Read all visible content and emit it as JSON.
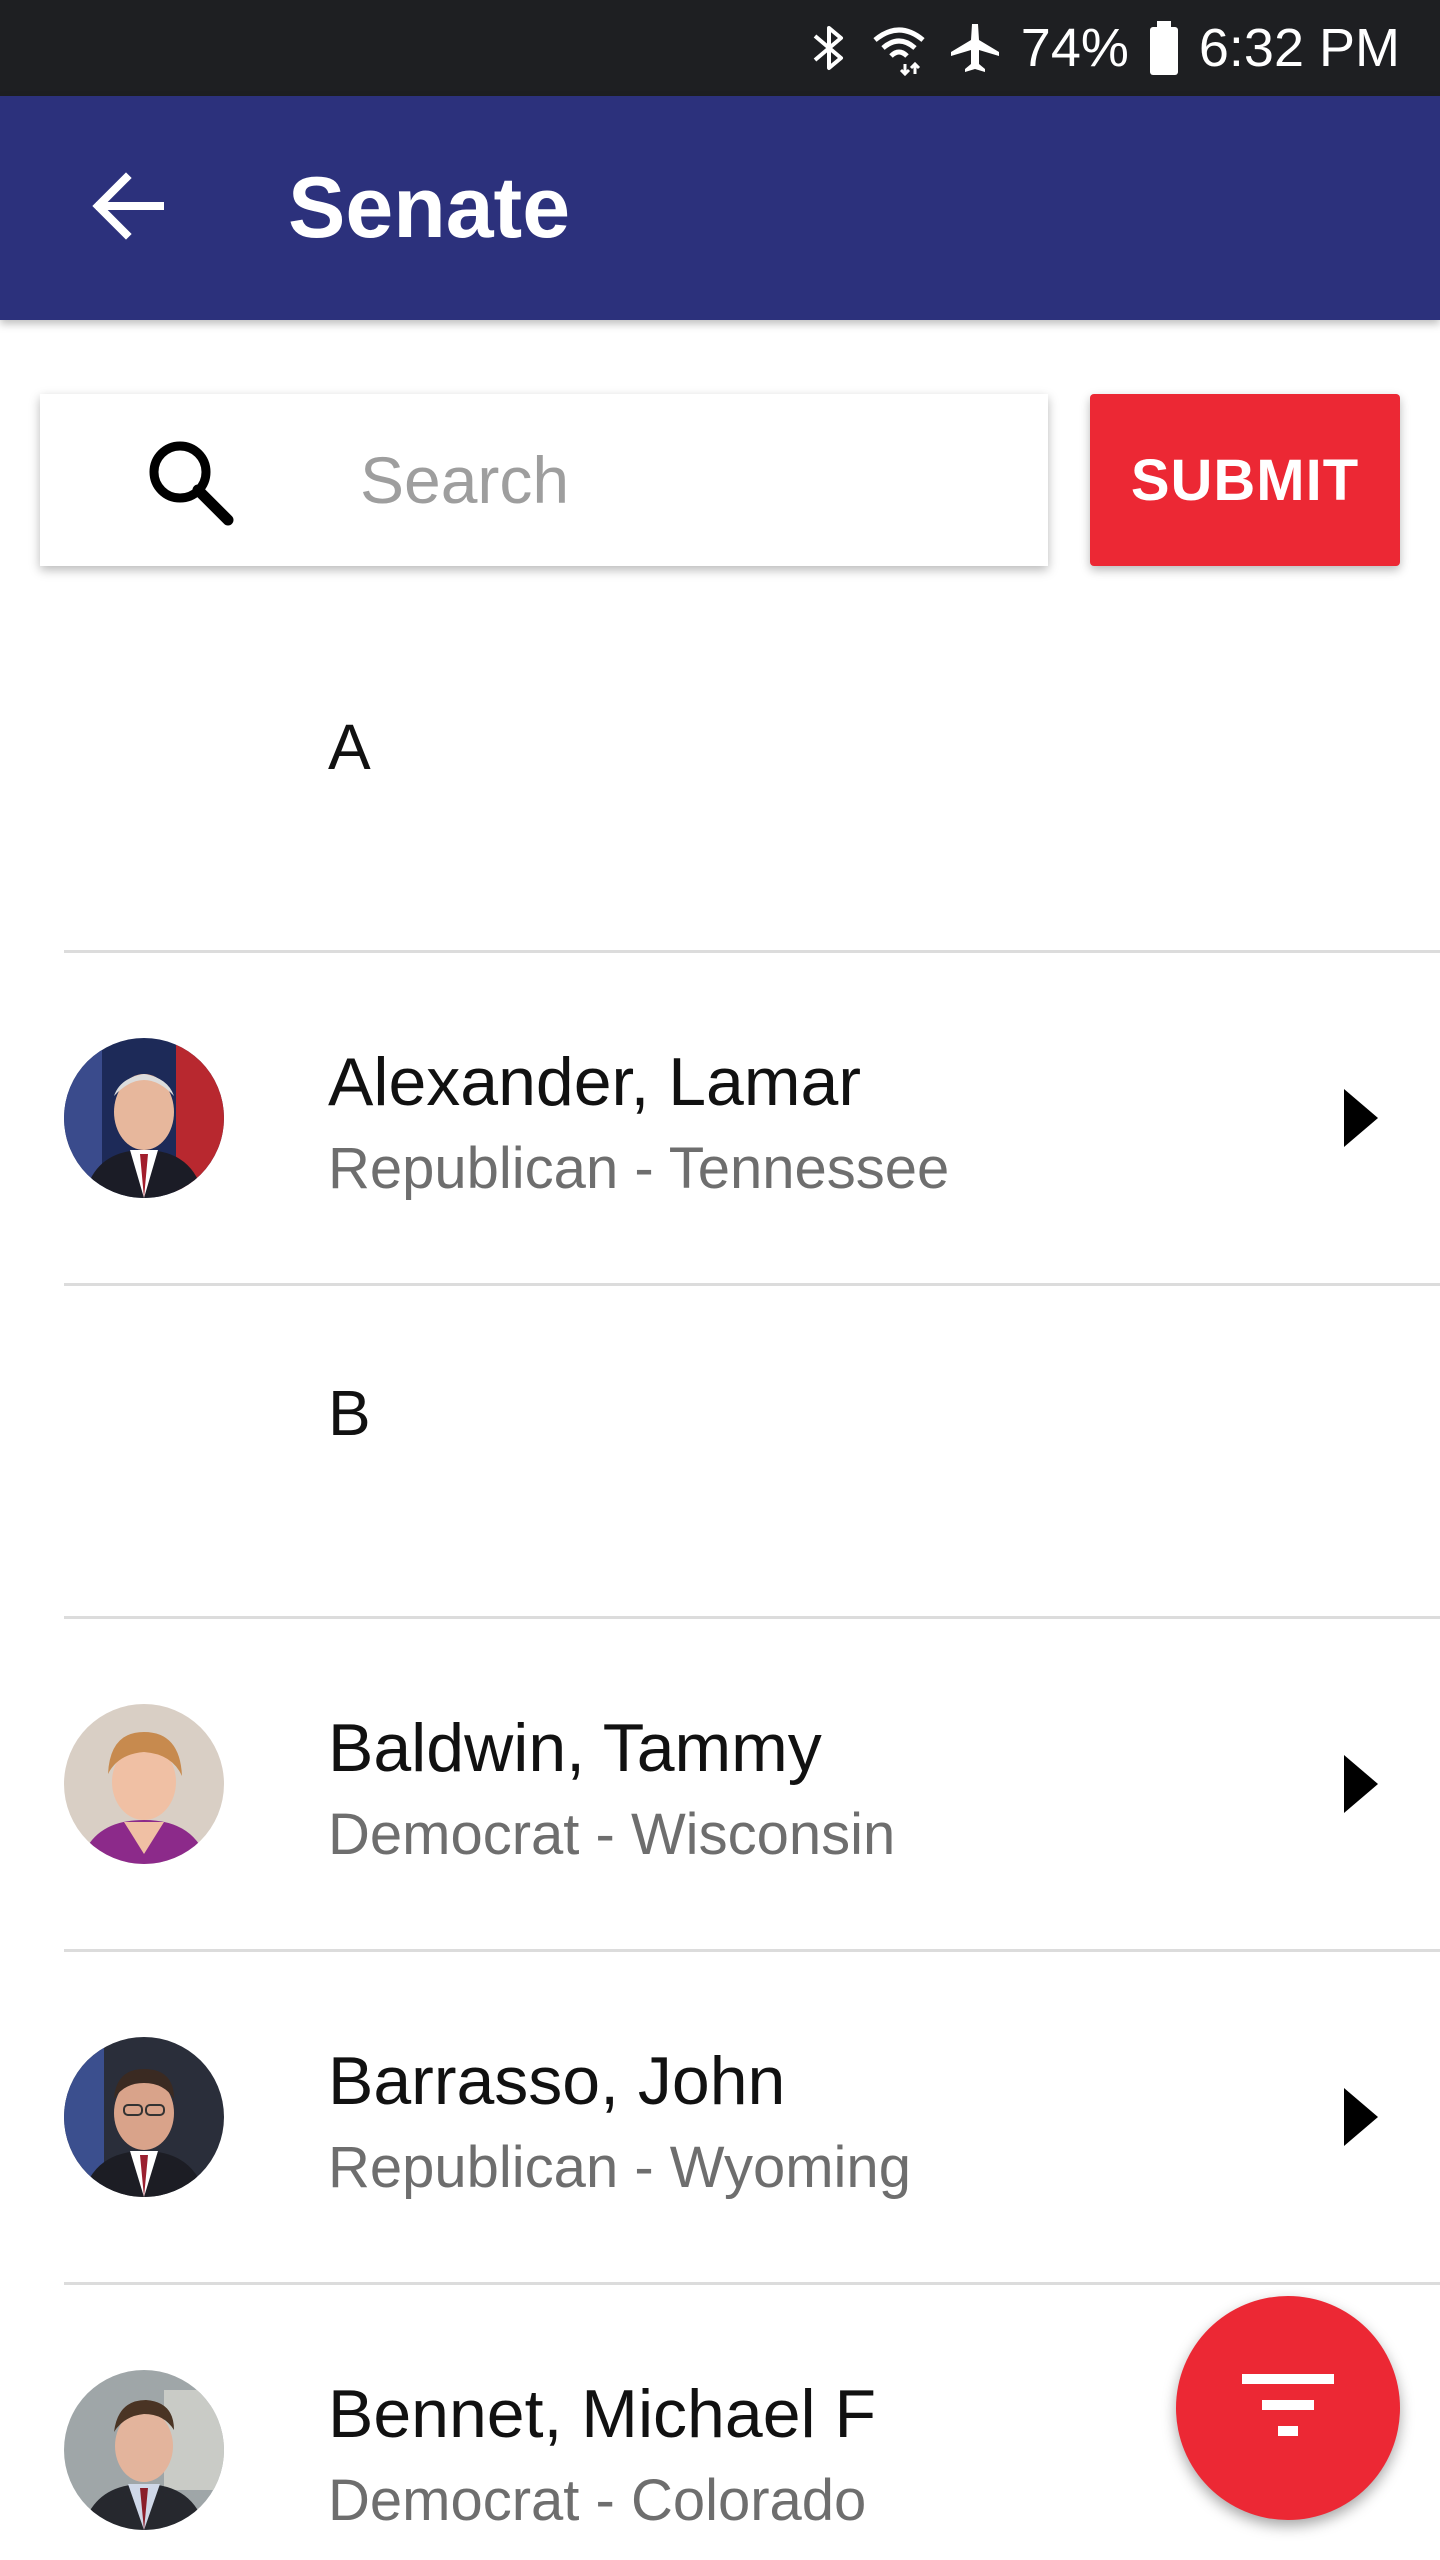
{
  "status_bar": {
    "icons": [
      "bluetooth-icon",
      "wifi-icon",
      "airplane-mode-icon",
      "battery-icon"
    ],
    "battery_percent": "74%",
    "time": "6:32 PM"
  },
  "app_bar": {
    "back_icon": "arrow-back-icon",
    "title": "Senate",
    "background_color": "#2c317c"
  },
  "search": {
    "icon": "search-icon",
    "placeholder": "Search",
    "value": ""
  },
  "submit": {
    "label": "SUBMIT",
    "color": "#ec2834"
  },
  "list": {
    "sections": [
      {
        "letter": "A",
        "people": [
          {
            "name": "Alexander, Lamar",
            "subtitle": "Republican - Tennessee"
          }
        ]
      },
      {
        "letter": "B",
        "people": [
          {
            "name": "Baldwin, Tammy",
            "subtitle": "Democrat - Wisconsin"
          },
          {
            "name": "Barrasso, John",
            "subtitle": "Republican - Wyoming"
          },
          {
            "name": "Bennet, Michael F",
            "subtitle": "Democrat - Colorado"
          }
        ]
      }
    ]
  },
  "fab": {
    "icon": "filter-icon",
    "color": "#ec2834"
  }
}
